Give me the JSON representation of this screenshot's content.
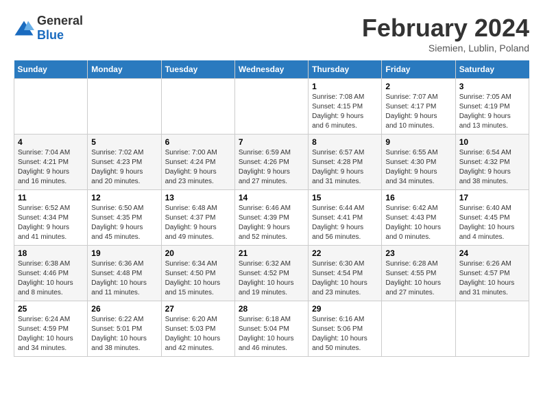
{
  "header": {
    "logo_general": "General",
    "logo_blue": "Blue",
    "title": "February 2024",
    "subtitle": "Siemien, Lublin, Poland"
  },
  "days_of_week": [
    "Sunday",
    "Monday",
    "Tuesday",
    "Wednesday",
    "Thursday",
    "Friday",
    "Saturday"
  ],
  "weeks": [
    [
      {
        "day": "",
        "info": ""
      },
      {
        "day": "",
        "info": ""
      },
      {
        "day": "",
        "info": ""
      },
      {
        "day": "",
        "info": ""
      },
      {
        "day": "1",
        "info": "Sunrise: 7:08 AM\nSunset: 4:15 PM\nDaylight: 9 hours\nand 6 minutes."
      },
      {
        "day": "2",
        "info": "Sunrise: 7:07 AM\nSunset: 4:17 PM\nDaylight: 9 hours\nand 10 minutes."
      },
      {
        "day": "3",
        "info": "Sunrise: 7:05 AM\nSunset: 4:19 PM\nDaylight: 9 hours\nand 13 minutes."
      }
    ],
    [
      {
        "day": "4",
        "info": "Sunrise: 7:04 AM\nSunset: 4:21 PM\nDaylight: 9 hours\nand 16 minutes."
      },
      {
        "day": "5",
        "info": "Sunrise: 7:02 AM\nSunset: 4:23 PM\nDaylight: 9 hours\nand 20 minutes."
      },
      {
        "day": "6",
        "info": "Sunrise: 7:00 AM\nSunset: 4:24 PM\nDaylight: 9 hours\nand 23 minutes."
      },
      {
        "day": "7",
        "info": "Sunrise: 6:59 AM\nSunset: 4:26 PM\nDaylight: 9 hours\nand 27 minutes."
      },
      {
        "day": "8",
        "info": "Sunrise: 6:57 AM\nSunset: 4:28 PM\nDaylight: 9 hours\nand 31 minutes."
      },
      {
        "day": "9",
        "info": "Sunrise: 6:55 AM\nSunset: 4:30 PM\nDaylight: 9 hours\nand 34 minutes."
      },
      {
        "day": "10",
        "info": "Sunrise: 6:54 AM\nSunset: 4:32 PM\nDaylight: 9 hours\nand 38 minutes."
      }
    ],
    [
      {
        "day": "11",
        "info": "Sunrise: 6:52 AM\nSunset: 4:34 PM\nDaylight: 9 hours\nand 41 minutes."
      },
      {
        "day": "12",
        "info": "Sunrise: 6:50 AM\nSunset: 4:35 PM\nDaylight: 9 hours\nand 45 minutes."
      },
      {
        "day": "13",
        "info": "Sunrise: 6:48 AM\nSunset: 4:37 PM\nDaylight: 9 hours\nand 49 minutes."
      },
      {
        "day": "14",
        "info": "Sunrise: 6:46 AM\nSunset: 4:39 PM\nDaylight: 9 hours\nand 52 minutes."
      },
      {
        "day": "15",
        "info": "Sunrise: 6:44 AM\nSunset: 4:41 PM\nDaylight: 9 hours\nand 56 minutes."
      },
      {
        "day": "16",
        "info": "Sunrise: 6:42 AM\nSunset: 4:43 PM\nDaylight: 10 hours\nand 0 minutes."
      },
      {
        "day": "17",
        "info": "Sunrise: 6:40 AM\nSunset: 4:45 PM\nDaylight: 10 hours\nand 4 minutes."
      }
    ],
    [
      {
        "day": "18",
        "info": "Sunrise: 6:38 AM\nSunset: 4:46 PM\nDaylight: 10 hours\nand 8 minutes."
      },
      {
        "day": "19",
        "info": "Sunrise: 6:36 AM\nSunset: 4:48 PM\nDaylight: 10 hours\nand 11 minutes."
      },
      {
        "day": "20",
        "info": "Sunrise: 6:34 AM\nSunset: 4:50 PM\nDaylight: 10 hours\nand 15 minutes."
      },
      {
        "day": "21",
        "info": "Sunrise: 6:32 AM\nSunset: 4:52 PM\nDaylight: 10 hours\nand 19 minutes."
      },
      {
        "day": "22",
        "info": "Sunrise: 6:30 AM\nSunset: 4:54 PM\nDaylight: 10 hours\nand 23 minutes."
      },
      {
        "day": "23",
        "info": "Sunrise: 6:28 AM\nSunset: 4:55 PM\nDaylight: 10 hours\nand 27 minutes."
      },
      {
        "day": "24",
        "info": "Sunrise: 6:26 AM\nSunset: 4:57 PM\nDaylight: 10 hours\nand 31 minutes."
      }
    ],
    [
      {
        "day": "25",
        "info": "Sunrise: 6:24 AM\nSunset: 4:59 PM\nDaylight: 10 hours\nand 34 minutes."
      },
      {
        "day": "26",
        "info": "Sunrise: 6:22 AM\nSunset: 5:01 PM\nDaylight: 10 hours\nand 38 minutes."
      },
      {
        "day": "27",
        "info": "Sunrise: 6:20 AM\nSunset: 5:03 PM\nDaylight: 10 hours\nand 42 minutes."
      },
      {
        "day": "28",
        "info": "Sunrise: 6:18 AM\nSunset: 5:04 PM\nDaylight: 10 hours\nand 46 minutes."
      },
      {
        "day": "29",
        "info": "Sunrise: 6:16 AM\nSunset: 5:06 PM\nDaylight: 10 hours\nand 50 minutes."
      },
      {
        "day": "",
        "info": ""
      },
      {
        "day": "",
        "info": ""
      }
    ]
  ]
}
